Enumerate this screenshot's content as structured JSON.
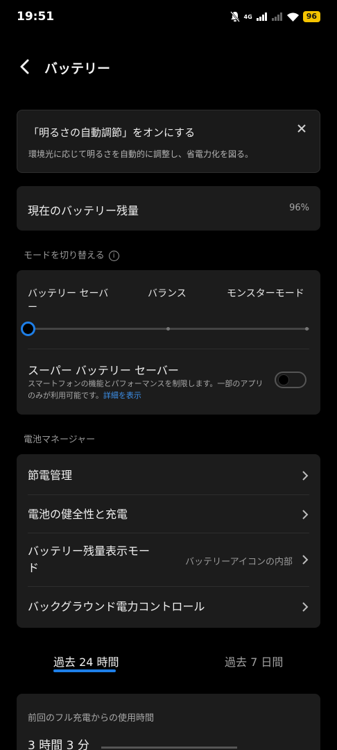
{
  "status_bar": {
    "time": "19:51",
    "network": "4G",
    "battery": "96"
  },
  "header": {
    "title": "バッテリー"
  },
  "banner": {
    "title": "「明るさの自動調節」をオンにする",
    "text": "環境光に応じて明るさを自動的に調整し、省電力化を図る。"
  },
  "battery_level": {
    "label": "現在のバッテリー残量",
    "value": "96%"
  },
  "mode_section": {
    "label": "モードを切り替える",
    "options": [
      "バッテリー セーバ\nー",
      "バランス",
      "モンスターモード"
    ],
    "selected_index": 0,
    "super_saver_title": "スーパー バッテリー セーバー",
    "super_saver_desc": "スマートフォンの機能とパフォーマンスを制限します。一部のアプリのみが利用可能です。",
    "super_saver_link": "詳細を表示",
    "super_saver_enabled": false
  },
  "manager_section": {
    "label": "電池マネージャー",
    "items": [
      {
        "label": "節電管理",
        "value": ""
      },
      {
        "label": "電池の健全性と充電",
        "value": ""
      },
      {
        "label": "バッテリー残量表示モー\nド",
        "value": "バッテリーアイコンの内部"
      },
      {
        "label": "バックグラウンド電力コントロール",
        "value": ""
      }
    ]
  },
  "tabs": {
    "active": "過去 24 時間",
    "inactive": "過去 7 日間"
  },
  "usage": {
    "label": "前回のフル充電からの使用時間",
    "value": "3 時間 3 分"
  },
  "colors": {
    "accent": "#1e7fe8",
    "battery_badge": "#f5c400",
    "card": "#1c1c1c"
  }
}
